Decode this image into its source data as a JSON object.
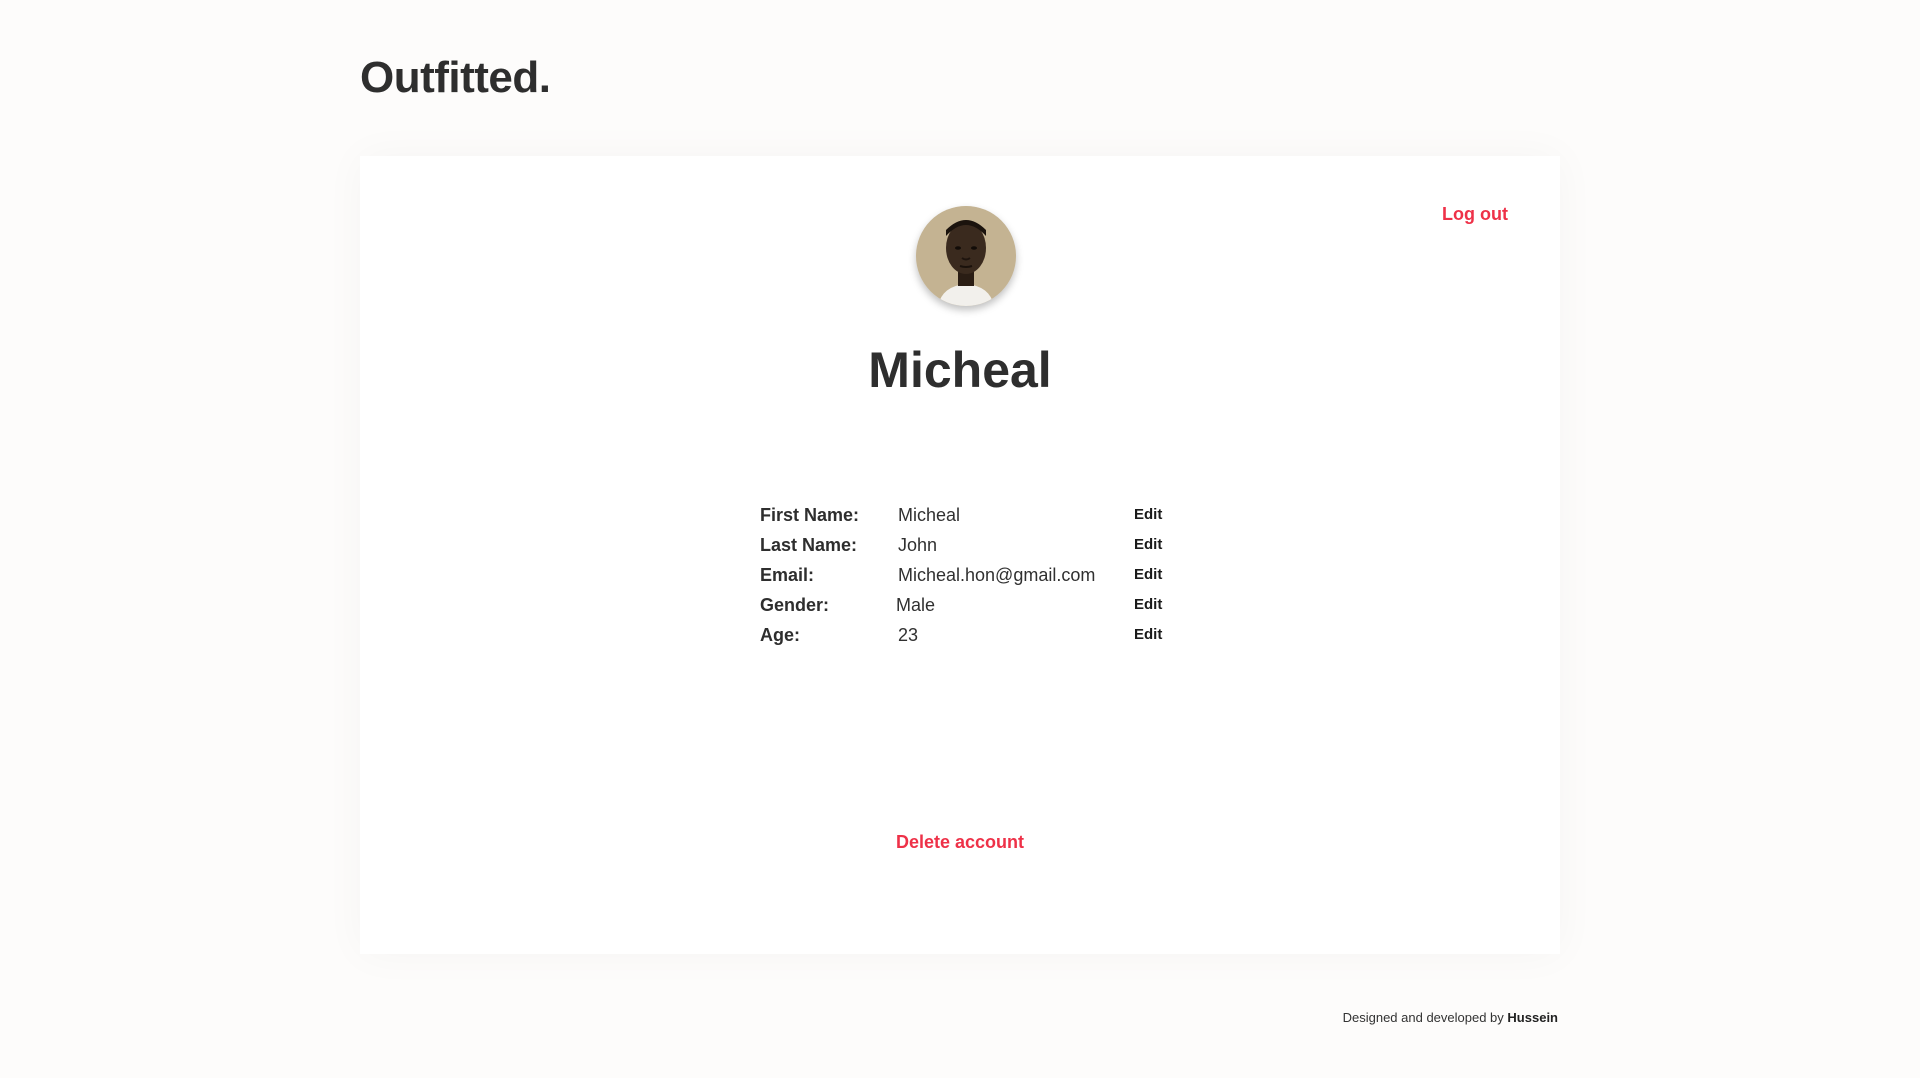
{
  "brand": {
    "logo_text": "Outfitted."
  },
  "header": {
    "logout_label": "Log out"
  },
  "profile": {
    "display_name": "Micheal",
    "avatar": "portrait-photo",
    "fields": [
      {
        "label": "First Name:",
        "value": "Micheal",
        "action": "Edit"
      },
      {
        "label": "Last Name:",
        "value": "John",
        "action": "Edit"
      },
      {
        "label": "Email:",
        "value": "Micheal.hon@gmail.com",
        "action": "Edit"
      },
      {
        "label": "Gender:",
        "value": "Male",
        "action": "Edit"
      },
      {
        "label": "Age:",
        "value": "23",
        "action": "Edit"
      }
    ],
    "delete_label": "Delete account"
  },
  "footer": {
    "text": "Designed and developed by",
    "author": "Hussein"
  },
  "colors": {
    "accent": "#ee3148",
    "background": "#fdfcfb",
    "card": "#ffffff",
    "text": "#2e2e2e"
  }
}
